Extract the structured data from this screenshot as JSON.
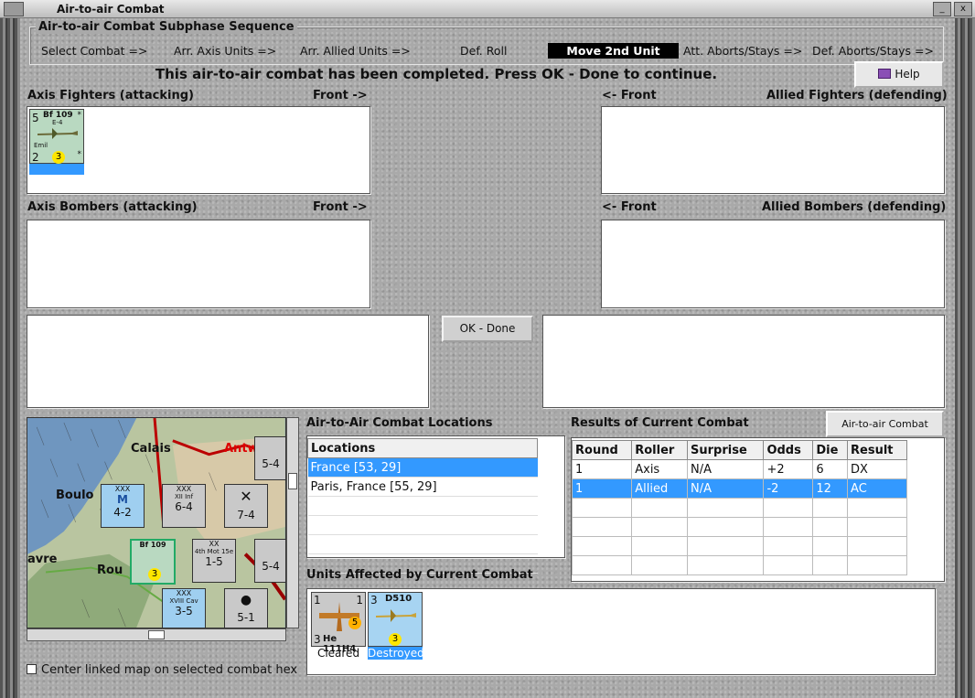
{
  "window": {
    "title": "Air-to-air Combat"
  },
  "subphase": {
    "title": "Air-to-air Combat Subphase Sequence",
    "steps": [
      "Select Combat =>",
      "Arr. Axis Units =>",
      "Arr. Allied Units =>",
      "Def. Roll",
      "Move 2nd Unit",
      "Att. Aborts/Stays =>",
      "Def. Aborts/Stays =>"
    ],
    "active_step": "Move 2nd Unit"
  },
  "status_message": "This air-to-air combat has been completed.  Press OK - Done to continue.",
  "help_label": "Help",
  "axis_fighters": {
    "label": "Axis Fighters (attacking)",
    "front": "Front ->",
    "unit": {
      "top_left": "5",
      "name": "Bf 109",
      "variant": "E-4",
      "subname": "Emil",
      "bottom_left": "2",
      "dot": "3",
      "star_top": "*",
      "star_bottom": "*"
    }
  },
  "allied_fighters": {
    "label": "Allied Fighters (defending)",
    "front": "<- Front"
  },
  "axis_bombers": {
    "label": "Axis Bombers (attacking)",
    "front": "Front ->"
  },
  "allied_bombers": {
    "label": "Allied Bombers (defending)",
    "front": "<- Front"
  },
  "ok_done_label": "OK - Done",
  "map": {
    "labels": [
      "Calais",
      "Antw",
      "Boulo",
      "avre",
      "Rou"
    ],
    "counters": [
      {
        "top": "XXX",
        "mid": "M",
        "bottom": "4-2",
        "color": "#9fcff0"
      },
      {
        "top": "XXX",
        "mid": "XII Inf",
        "bottom": "6-4",
        "color": "#c7c7c7"
      },
      {
        "top": "",
        "mid": "",
        "bottom": "7-4",
        "color": "#c7c7c7"
      },
      {
        "top": "XX",
        "mid": "4th Mot 15e",
        "bottom": "1-5",
        "color": "#c7c7c7"
      },
      {
        "top": "XXX",
        "mid": "XVIII Cav",
        "bottom": "3-5",
        "color": "#9fcff0"
      },
      {
        "top": "",
        "mid": "",
        "bottom": "5-1",
        "color": "#c7c7c7"
      },
      {
        "top": "",
        "mid": "",
        "bottom": "5-4",
        "color": "#c7c7c7"
      },
      {
        "top": "",
        "mid": "",
        "bottom": "5-4",
        "color": "#c7c7c7"
      }
    ],
    "center_checkbox_label": "Center linked map on selected combat hex"
  },
  "locations": {
    "heading": "Air-to-Air Combat Locations",
    "column": "Locations",
    "rows": [
      "France [53, 29]",
      "Paris, France [55, 29]",
      "",
      "",
      "",
      ""
    ],
    "selected_index": 0
  },
  "results": {
    "heading": "Results of Current Combat",
    "chart_button": "Air-to-air Combat Chart",
    "columns": [
      "Round",
      "Roller",
      "Surprise",
      "Odds",
      "Die",
      "Result"
    ],
    "rows": [
      [
        "1",
        "Axis",
        "N/A",
        "+2",
        "6",
        "DX"
      ],
      [
        "1",
        "Allied",
        "N/A",
        "-2",
        "12",
        "AC"
      ],
      [
        "",
        "",
        "",
        "",
        "",
        ""
      ],
      [
        "",
        "",
        "",
        "",
        "",
        ""
      ],
      [
        "",
        "",
        "",
        "",
        "",
        ""
      ],
      [
        "",
        "",
        "",
        "",
        "",
        ""
      ]
    ],
    "selected_index": 1
  },
  "units_affected": {
    "heading": "Units Affected by Current Combat",
    "units": [
      {
        "top_left": "1",
        "top_right": "1",
        "bottom_left": "3",
        "name": "He 111H4",
        "dot": "5",
        "caption": "Cleared"
      },
      {
        "top_left": "3",
        "name": "D510",
        "dot": "3",
        "caption": "Destroyed"
      }
    ]
  }
}
